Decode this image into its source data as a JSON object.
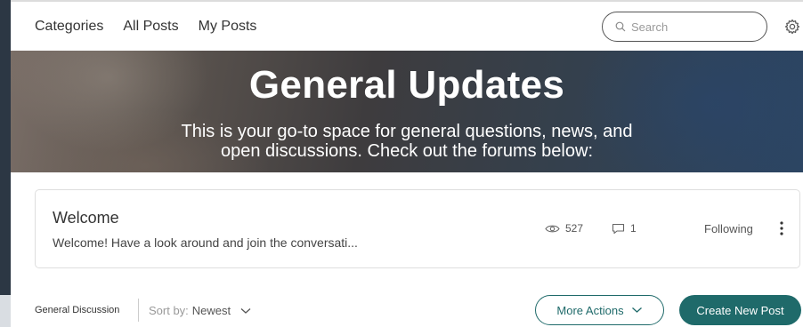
{
  "nav": {
    "items": [
      "Categories",
      "All Posts",
      "My Posts"
    ]
  },
  "search": {
    "placeholder": "Search",
    "icon": "search-icon"
  },
  "settings": {
    "icon": "gear-icon"
  },
  "hero": {
    "title": "General Updates",
    "subtitle_line1": "This is your go-to space for general questions, news, and",
    "subtitle_line2": "open discussions. Check out the forums below:"
  },
  "post": {
    "title": "Welcome",
    "excerpt": "Welcome! Have a look around and join the conversati...",
    "views": "527",
    "comments": "1",
    "follow_label": "Following"
  },
  "footer": {
    "breadcrumb": "General Discussion",
    "sort_label": "Sort by:",
    "sort_value": "Newest",
    "more_actions_label": "More Actions",
    "create_label": "Create New Post"
  },
  "colors": {
    "accent": "#1f6a6a",
    "sidebar_dark": "#2c3744"
  }
}
